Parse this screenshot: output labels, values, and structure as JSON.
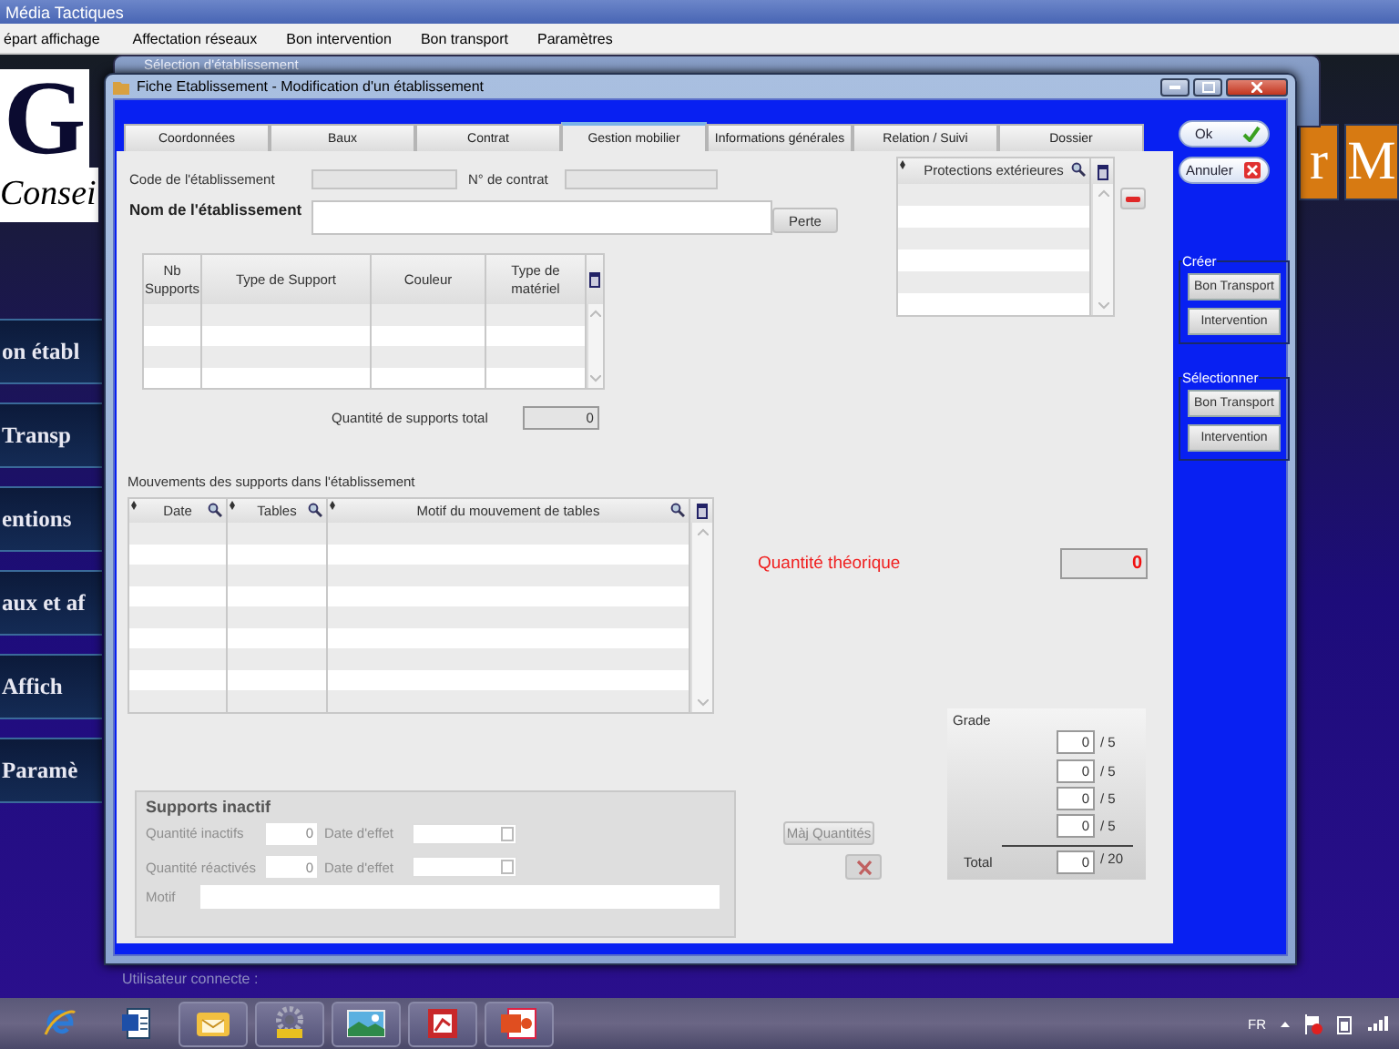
{
  "app": {
    "title": "Média Tactiques",
    "menu": [
      {
        "label": "épart affichage"
      },
      {
        "label": "Affectation réseaux"
      },
      {
        "label": "Bon intervention"
      },
      {
        "label": "Bon transport"
      },
      {
        "label": "Paramètres"
      }
    ],
    "logo": {
      "line_1": "G",
      "line_2": "Consei"
    },
    "side_menu": [
      {
        "label": "on établ"
      },
      {
        "label": "Transp"
      },
      {
        "label": "entions"
      },
      {
        "label": "aux et af"
      },
      {
        "label": "Affich"
      },
      {
        "label": "Paramè"
      }
    ],
    "tiles": [
      {
        "label": "r"
      },
      {
        "label": "M"
      }
    ],
    "status": "Utilisateur connecte :"
  },
  "background_window": {
    "title": "Sélection d'établissement"
  },
  "dialog": {
    "title": "Fiche Etablissement - Modification d'un établissement",
    "tabs": [
      {
        "label": "Coordonnées",
        "selected": false
      },
      {
        "label": "Baux",
        "selected": false
      },
      {
        "label": "Contrat",
        "selected": false
      },
      {
        "label": "Gestion mobilier",
        "selected": true
      },
      {
        "label": "Informations générales",
        "selected": false
      },
      {
        "label": "Relation / Suivi",
        "selected": false
      },
      {
        "label": "Dossier",
        "selected": false
      }
    ],
    "code": {
      "label": "Code de l'établissement"
    },
    "contract": {
      "label": "N° de contrat"
    },
    "name": {
      "label": "Nom de l'établissement"
    },
    "loss_button": "Perte",
    "supports_table": {
      "columns": [
        "Nb Supports",
        "Type de Support",
        "Couleur",
        "Type de matériel"
      ]
    },
    "supports_total": {
      "label": "Quantité de supports total",
      "value": "0"
    },
    "movements": {
      "title": "Mouvements des supports dans l'établissement",
      "columns": [
        "Date",
        "Tables",
        "Motif du mouvement de tables"
      ]
    },
    "protections": {
      "columns": [
        "Protections extérieures"
      ]
    },
    "theoretical": {
      "label": "Quantité théorique",
      "value": "0"
    },
    "inactive": {
      "title": "Supports inactif",
      "disabled": true,
      "inactive_qty": {
        "label": "Quantité inactifs",
        "value": "0"
      },
      "inactive_date": {
        "label": "Date d'effet"
      },
      "reactivated_qty": {
        "label": "Quantité réactivés",
        "value": "0"
      },
      "reactivated_date": {
        "label": "Date d'effet"
      },
      "update_button": "Màj Quantités",
      "motif": {
        "label": "Motif"
      }
    },
    "grade": {
      "title": "Grade",
      "rows": [
        {
          "value": "0",
          "max": "/ 5"
        },
        {
          "value": "0",
          "max": "/ 5"
        },
        {
          "value": "0",
          "max": "/ 5"
        },
        {
          "value": "0",
          "max": "/ 5"
        }
      ],
      "total": {
        "label": "Total",
        "value": "0",
        "max": "/ 20"
      }
    },
    "actions": {
      "ok": "Ok",
      "cancel": "Annuler",
      "groups": [
        {
          "title": "Créer",
          "buttons": [
            "Bon Transport",
            "Intervention"
          ]
        },
        {
          "title": "Sélectionner",
          "buttons": [
            "Bon Transport",
            "Intervention"
          ]
        }
      ]
    }
  },
  "taskbar": {
    "language": "FR"
  }
}
